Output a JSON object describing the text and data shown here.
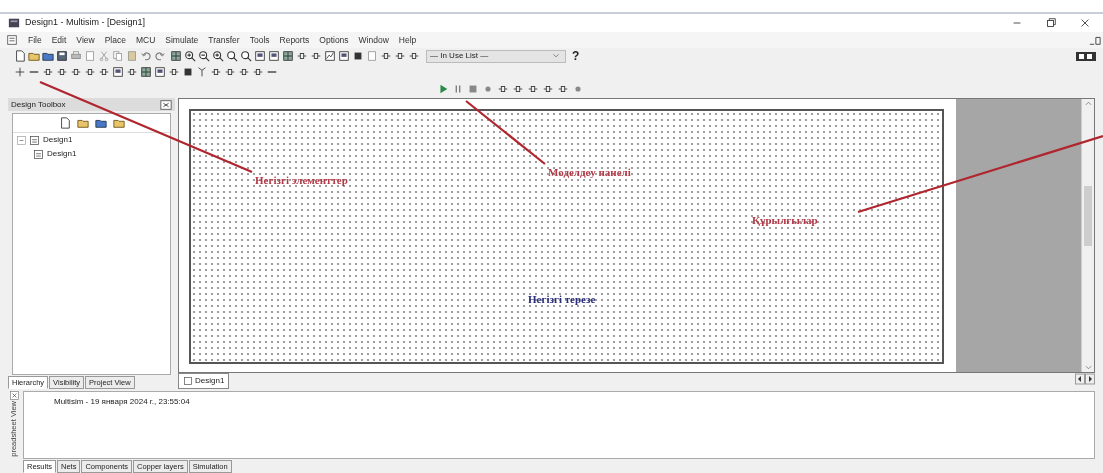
{
  "window": {
    "title": "Design1 - Multisim - [Design1]"
  },
  "menu": [
    "File",
    "Edit",
    "View",
    "Place",
    "MCU",
    "Simulate",
    "Transfer",
    "Tools",
    "Reports",
    "Options",
    "Window",
    "Help"
  ],
  "toolbar": {
    "in_use_list": {
      "value": "— In Use List —"
    },
    "help": "?"
  },
  "design_toolbox": {
    "title": "Design Toolbox",
    "tree": [
      {
        "label": "Design1",
        "expanded": true,
        "children": [
          {
            "label": "Design1"
          }
        ]
      }
    ],
    "tabs": [
      {
        "label": "Hierarchy",
        "selected": true
      },
      {
        "label": "Visibility",
        "selected": false
      },
      {
        "label": "Project View",
        "selected": false
      }
    ]
  },
  "canvas_tabs": [
    {
      "label": "Design1",
      "selected": true
    }
  ],
  "spreadsheet": {
    "title": "preadsheet View",
    "log": "Multisim  -  19 января 2024 г., 23:55:04",
    "tabs": [
      {
        "label": "Results",
        "selected": true
      },
      {
        "label": "Nets",
        "selected": false
      },
      {
        "label": "Components",
        "selected": false
      },
      {
        "label": "Copper layers",
        "selected": false
      },
      {
        "label": "Simulation",
        "selected": false
      }
    ]
  },
  "annotations": [
    {
      "text": "Негізгі элементтер",
      "color": "#b23a48"
    },
    {
      "text": "Моделдеу панелі",
      "color": "#b23a48"
    },
    {
      "text": "Құрылғылар",
      "color": "#b23a48"
    },
    {
      "text": "Негізгі терезе",
      "color": "#2b2f7a"
    }
  ]
}
